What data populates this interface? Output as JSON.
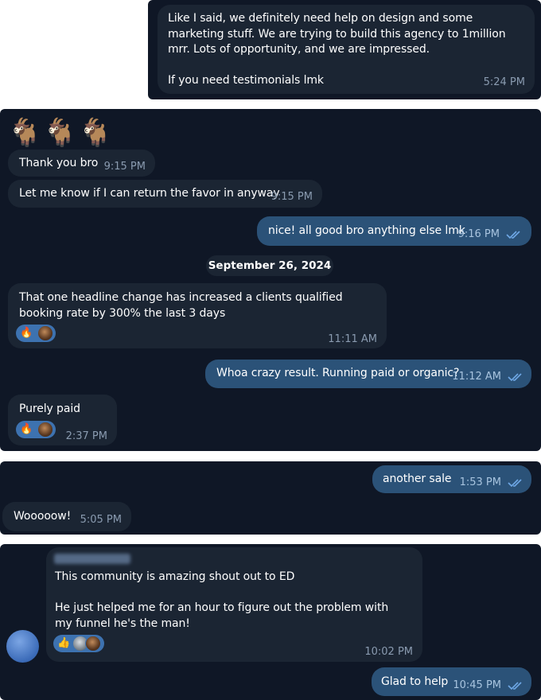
{
  "panel1": {
    "message": {
      "text": "Like I said, we definitely need help on design and some marketing stuff. We are trying to build this agency to 1million mrr. Lots of opportunity, and we are impressed.\n\nIf you need testimonials lmk",
      "time": "5:24 PM"
    }
  },
  "panel2": {
    "sticker": "🐐🐐🐐",
    "messages": [
      {
        "text": "Thank you bro",
        "time": "9:15 PM"
      },
      {
        "text": "Let me know if I can return the favor in anyway",
        "time": "9:15 PM"
      },
      {
        "text": "nice! all good bro anything else lmk",
        "time": "9:16 PM"
      }
    ],
    "date": "September 26, 2024",
    "headline_msg": {
      "text": "That one headline change has increased a clients qualified booking rate by 300% the last 3 days",
      "time": "11:11 AM",
      "reaction": "🔥"
    },
    "reply_msg": {
      "text": "Whoa crazy result. Running paid or organic?",
      "time": "11:12 AM"
    },
    "paid_msg": {
      "text": "Purely paid",
      "time": "2:37 PM",
      "reaction": "🔥"
    }
  },
  "panel3": {
    "messages": [
      {
        "text": "another sale",
        "time": "1:53 PM"
      },
      {
        "text": "Wooooow!",
        "time": "5:05 PM"
      }
    ]
  },
  "panel4": {
    "community_msg": {
      "text": "This community is amazing shout out to ED\n\nHe just helped me for an hour to figure out the problem with my funnel he's the man!",
      "time": "10:02 PM",
      "reaction": "👍"
    },
    "reply": {
      "text": "Glad to help",
      "time": "10:45 PM"
    }
  },
  "colors": {
    "panel_bg": "#0f1726",
    "incoming_bubble": "#1b2533",
    "outgoing_bubble": "#2b5278",
    "reaction_bg": "#3d72b0",
    "read_ticks": "#6fa8e6"
  }
}
